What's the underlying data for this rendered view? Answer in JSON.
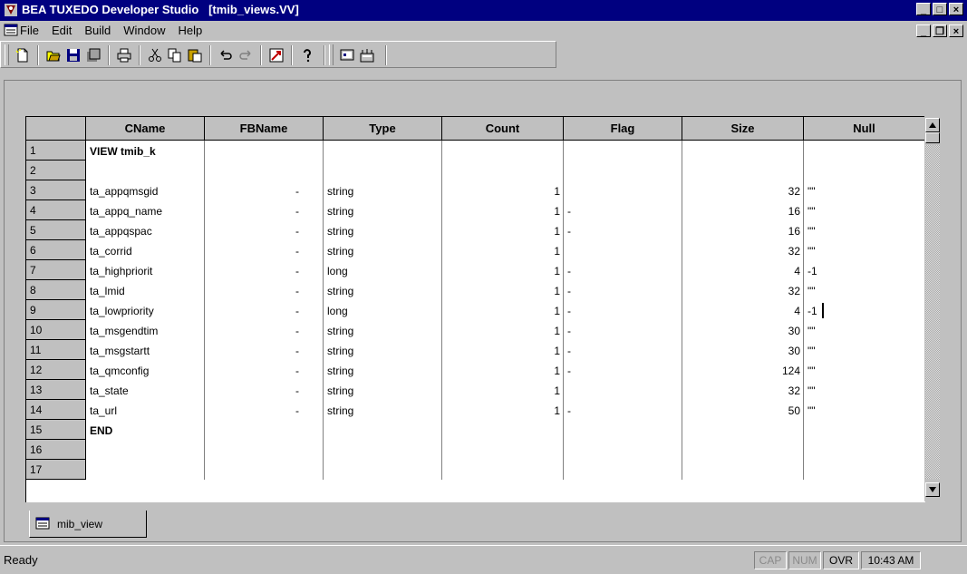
{
  "window": {
    "title": "BEA TUXEDO Developer Studio   [tmib_views.VV]",
    "controls": [
      "_",
      "□",
      "×"
    ]
  },
  "menubar": {
    "items": [
      "File",
      "Edit",
      "Build",
      "Window",
      "Help"
    ],
    "doc_controls": [
      "_",
      "❐",
      "×"
    ]
  },
  "toolbar": {
    "buttons": [
      "new-icon",
      "open-icon",
      "save-icon",
      "save-all-icon",
      "print-icon",
      "cut-icon",
      "copy-icon",
      "paste-icon",
      "undo-icon",
      "redo-icon",
      "build-icon",
      "help-icon",
      "view-icon",
      "config-icon"
    ]
  },
  "grid": {
    "columns": [
      "CName",
      "FBName",
      "Type",
      "Count",
      "Flag",
      "Size",
      "Null"
    ],
    "rows": [
      {
        "n": "1",
        "cname": "VIEW tmib_k",
        "fbname": "",
        "type": "",
        "count": "",
        "flag": "",
        "size": "",
        "null": "",
        "bold": true
      },
      {
        "n": "2",
        "cname": "",
        "fbname": "",
        "type": "",
        "count": "",
        "flag": "",
        "size": "",
        "null": ""
      },
      {
        "n": "3",
        "cname": "ta_appqmsgid",
        "fbname": "-",
        "type": "string",
        "count": "1",
        "flag": "",
        "size": "32",
        "null": "\"\""
      },
      {
        "n": "4",
        "cname": "ta_appq_name",
        "fbname": "-",
        "type": "string",
        "count": "1",
        "flag": "-",
        "size": "16",
        "null": "\"\""
      },
      {
        "n": "5",
        "cname": "ta_appqspac",
        "fbname": "-",
        "type": "string",
        "count": "1",
        "flag": "-",
        "size": "16",
        "null": "\"\""
      },
      {
        "n": "6",
        "cname": "ta_corrid",
        "fbname": "-",
        "type": "string",
        "count": "1",
        "flag": "",
        "size": "32",
        "null": "\"\""
      },
      {
        "n": "7",
        "cname": "ta_highpriorit",
        "fbname": "-",
        "type": "long",
        "count": "1",
        "flag": "-",
        "size": "4",
        "null": "-1"
      },
      {
        "n": "8",
        "cname": "ta_lmid",
        "fbname": "-",
        "type": "string",
        "count": "1",
        "flag": "-",
        "size": "32",
        "null": "\"\""
      },
      {
        "n": "9",
        "cname": "ta_lowpriority",
        "fbname": "-",
        "type": "long",
        "count": "1",
        "flag": "-",
        "size": "4",
        "null": "-1"
      },
      {
        "n": "10",
        "cname": "ta_msgendtim",
        "fbname": "-",
        "type": "string",
        "count": "1",
        "flag": "-",
        "size": "30",
        "null": "\"\""
      },
      {
        "n": "11",
        "cname": "ta_msgstartt",
        "fbname": "-",
        "type": "string",
        "count": "1",
        "flag": "-",
        "size": "30",
        "null": "\"\""
      },
      {
        "n": "12",
        "cname": "ta_qmconfig",
        "fbname": "-",
        "type": "string",
        "count": "1",
        "flag": "-",
        "size": "124",
        "null": "\"\""
      },
      {
        "n": "13",
        "cname": "ta_state",
        "fbname": "-",
        "type": "string",
        "count": "1",
        "flag": "",
        "size": "32",
        "null": "\"\""
      },
      {
        "n": "14",
        "cname": "ta_url",
        "fbname": "-",
        "type": "string",
        "count": "1",
        "flag": "-",
        "size": "50",
        "null": "\"\""
      },
      {
        "n": "15",
        "cname": "END",
        "fbname": "",
        "type": "",
        "count": "",
        "flag": "",
        "size": "",
        "null": "",
        "bold": true
      },
      {
        "n": "16",
        "cname": "",
        "fbname": "",
        "type": "",
        "count": "",
        "flag": "",
        "size": "",
        "null": ""
      },
      {
        "n": "17",
        "cname": "",
        "fbname": "",
        "type": "",
        "count": "",
        "flag": "",
        "size": "",
        "null": ""
      }
    ]
  },
  "tabs": [
    {
      "label": "mib_view"
    }
  ],
  "status": {
    "text": "Ready",
    "indicators": [
      {
        "label": "CAP",
        "active": false
      },
      {
        "label": "NUM",
        "active": false
      },
      {
        "label": "OVR",
        "active": true
      },
      {
        "label": "10:43 AM",
        "active": true
      }
    ]
  }
}
